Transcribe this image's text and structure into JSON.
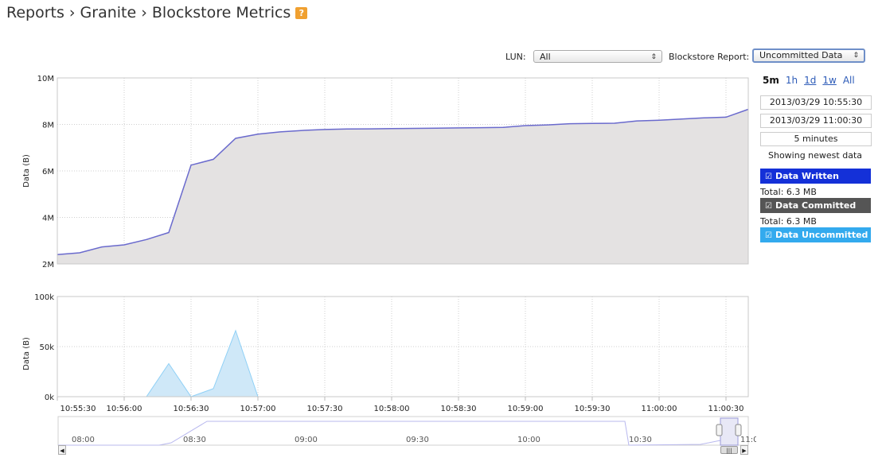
{
  "breadcrumb": {
    "text": "Reports › Granite › Blockstore Metrics",
    "help_icon": "?"
  },
  "controls": {
    "lun_label": "LUN:",
    "lun_value": "All",
    "report_label": "Blockstore Report:",
    "report_value": "Uncommitted Data"
  },
  "time_ranges": [
    {
      "label": "5m",
      "active": true
    },
    {
      "label": "1h",
      "active": false
    },
    {
      "label": "1d",
      "active": false
    },
    {
      "label": "1w",
      "active": false
    },
    {
      "label": "All",
      "active": false
    }
  ],
  "date_range": {
    "start": "2013/03/29 10:55:30",
    "end": "2013/03/29 11:00:30",
    "duration": "5 minutes",
    "status": "Showing newest data"
  },
  "series_toggles": [
    {
      "label": "Data Written",
      "color": "#1430d8",
      "total": "Total: 6.3 MB"
    },
    {
      "label": "Data Committed",
      "color": "#555555",
      "total": "Total: 6.3 MB"
    },
    {
      "label": "Data Uncommitted",
      "color": "#33aaee",
      "total": ""
    }
  ],
  "chart_data": [
    {
      "type": "area",
      "ylabel": "Data (B)",
      "yticks": [
        "2M",
        "4M",
        "6M",
        "8M",
        "10M"
      ],
      "ylim": [
        2000000,
        10000000
      ],
      "xlim_seconds": [
        0,
        310
      ],
      "x": [
        0,
        10,
        20,
        30,
        40,
        50,
        60,
        70,
        80,
        90,
        100,
        110,
        120,
        130,
        140,
        150,
        160,
        170,
        180,
        190,
        200,
        210,
        220,
        230,
        240,
        250,
        260,
        270,
        280,
        290,
        300,
        310
      ],
      "series": [
        {
          "name": "Data Written",
          "color": "#6a6acd",
          "values": [
            2400000,
            2480000,
            2730000,
            2820000,
            3050000,
            3350000,
            6250000,
            6500000,
            7400000,
            7580000,
            7680000,
            7740000,
            7780000,
            7800000,
            7810000,
            7820000,
            7830000,
            7840000,
            7850000,
            7860000,
            7870000,
            7950000,
            7980000,
            8030000,
            8040000,
            8050000,
            8150000,
            8180000,
            8230000,
            8280000,
            8310000,
            8650000
          ]
        }
      ],
      "grid": true
    },
    {
      "type": "area",
      "ylabel": "Data (B)",
      "yticks": [
        "0k",
        "50k",
        "100k"
      ],
      "ylim": [
        0,
        100000
      ],
      "xlim_seconds": [
        0,
        310
      ],
      "x": [
        0,
        10,
        20,
        30,
        40,
        50,
        60,
        70,
        80,
        90,
        100,
        110,
        120,
        130,
        140,
        150,
        160,
        170,
        180,
        190,
        200,
        210,
        220,
        230,
        240,
        250,
        260,
        270,
        280,
        290,
        300,
        310
      ],
      "series": [
        {
          "name": "Data Uncommitted",
          "color": "#66c0f0",
          "values": [
            0,
            0,
            0,
            0,
            0,
            33000,
            0,
            8000,
            66000,
            0,
            0,
            0,
            0,
            0,
            0,
            0,
            0,
            0,
            0,
            0,
            0,
            0,
            0,
            0,
            0,
            0,
            0,
            0,
            0,
            0,
            0,
            0
          ]
        }
      ],
      "grid": true
    }
  ],
  "x_axis_labels": [
    "10:55:30",
    "10:56:00",
    "10:56:30",
    "10:57:00",
    "10:57:30",
    "10:58:00",
    "10:58:30",
    "10:59:00",
    "10:59:30",
    "11:00:00",
    "11:00:30"
  ],
  "x_axis_seconds": [
    0,
    30,
    60,
    90,
    120,
    150,
    180,
    210,
    240,
    270,
    300
  ],
  "navigator": {
    "labels": [
      "08:00",
      "08:30",
      "09:00",
      "09:30",
      "10:00",
      "10:30",
      "11:0"
    ]
  }
}
